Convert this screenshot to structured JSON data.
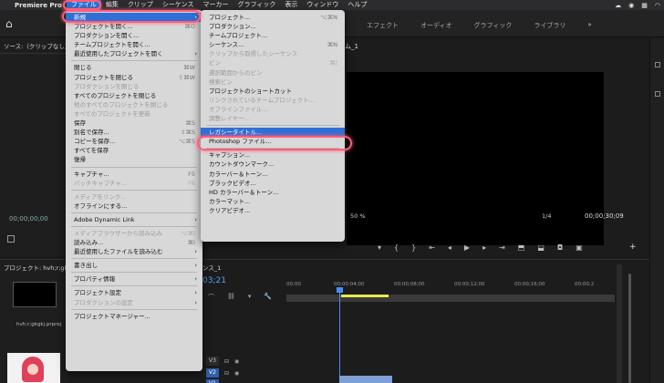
{
  "menubar": {
    "app_name": "Premiere Pro",
    "items": [
      "ファイル",
      "編集",
      "クリップ",
      "シーケンス",
      "マーカー",
      "グラフィック",
      "表示",
      "ウィンドウ",
      "ヘルプ"
    ]
  },
  "header": {
    "tabs": [
      "エフェクト",
      "オーディオ",
      "グラフィック",
      "ライブラリ"
    ],
    "more": "»"
  },
  "source_panel": {
    "title": "ソース:（クリップなし）",
    "timecode": "00;00;00;00"
  },
  "program_monitor": {
    "title": "ム_1",
    "zoom": "50 %",
    "fraction": "1/4",
    "end_timecode": "00;00;30;09"
  },
  "project_panel": {
    "title": "プロジェクト: hvh;r;gkgkj",
    "file_name": "hvh;r;gkgkj.prproj"
  },
  "timeline": {
    "title": "ンス_1",
    "timecode": "03;21",
    "ruler": [
      "00;00",
      "00;00;04;00",
      "00;00;08;00",
      "00;00;12;00",
      "00;00;16;00",
      "00;00;2"
    ],
    "tracks": [
      {
        "label": "V3",
        "active": false
      },
      {
        "label": "V2",
        "active": true
      },
      {
        "label": "V1",
        "active": true
      }
    ]
  },
  "file_menu": [
    {
      "label": "新規",
      "shortcut": "",
      "arrow": true,
      "highlight": true
    },
    {
      "label": "プロジェクトを開く...",
      "shortcut": "⌘O"
    },
    {
      "label": "プロダクションを開く...",
      "shortcut": ""
    },
    {
      "label": "チームプロジェクトを開く...",
      "shortcut": ""
    },
    {
      "label": "最近使用したプロジェクトを開く",
      "shortcut": "",
      "arrow": true
    },
    {
      "sep": true
    },
    {
      "label": "閉じる",
      "shortcut": "⌘W"
    },
    {
      "label": "プロジェクトを閉じる",
      "shortcut": "⇧⌘W"
    },
    {
      "label": "プロダクションを閉じる",
      "disabled": true
    },
    {
      "label": "すべてのプロジェクトを閉じる"
    },
    {
      "label": "他のすべてのプロジェクトを閉じる",
      "disabled": true
    },
    {
      "label": "すべてのプロジェクトを更新",
      "disabled": true
    },
    {
      "label": "保存",
      "shortcut": "⌘S"
    },
    {
      "label": "別名で保存...",
      "shortcut": "⇧⌘S"
    },
    {
      "label": "コピーを保存...",
      "shortcut": "⌥⌘S"
    },
    {
      "label": "すべてを保存"
    },
    {
      "label": "復帰"
    },
    {
      "sep": true
    },
    {
      "label": "キャプチャ...",
      "shortcut": "F5"
    },
    {
      "label": "バッチキャプチャ...",
      "shortcut": "F6",
      "disabled": true
    },
    {
      "sep": true
    },
    {
      "label": "メディアをリンク...",
      "disabled": true
    },
    {
      "label": "オフラインにする...",
      "shortcut": ""
    },
    {
      "sep": true
    },
    {
      "label": "Adobe Dynamic Link",
      "arrow": true
    },
    {
      "sep": true
    },
    {
      "label": "メディアブラウザーから読み込み",
      "shortcut": "⌥⌘I",
      "disabled": true
    },
    {
      "label": "読み込み...",
      "shortcut": "⌘I"
    },
    {
      "label": "最近使用したファイルを読み込む",
      "arrow": true
    },
    {
      "sep": true
    },
    {
      "label": "書き出し",
      "arrow": true
    },
    {
      "sep": true
    },
    {
      "label": "プロパティ情報",
      "arrow": true
    },
    {
      "sep": true
    },
    {
      "label": "プロジェクト設定",
      "arrow": true
    },
    {
      "label": "プロダクションの設定",
      "arrow": true,
      "disabled": true
    },
    {
      "sep": true
    },
    {
      "label": "プロジェクトマネージャー..."
    }
  ],
  "new_submenu": [
    {
      "label": "プロジェクト...",
      "shortcut": "⌥⌘N"
    },
    {
      "label": "プロダクション..."
    },
    {
      "label": "チームプロジェクト..."
    },
    {
      "label": "シーケンス...",
      "shortcut": "⌘N"
    },
    {
      "label": "クリップから取得したシーケンス",
      "disabled": true
    },
    {
      "label": "ビン",
      "shortcut": "⌘/",
      "disabled": true
    },
    {
      "label": "選択範囲からのビン",
      "disabled": true
    },
    {
      "label": "検索ビン",
      "disabled": true
    },
    {
      "label": "プロジェクトのショートカット"
    },
    {
      "label": "リンクされているチームプロジェクト...",
      "disabled": true
    },
    {
      "label": "オフラインファイル...",
      "disabled": true
    },
    {
      "label": "調整レイヤー...",
      "disabled": true
    },
    {
      "sep": true
    },
    {
      "label": "レガシータイトル...",
      "highlight": true
    },
    {
      "label": "Photoshop ファイル..."
    },
    {
      "sep": true
    },
    {
      "label": "キャプション..."
    },
    {
      "label": "カウントダウンマーク..."
    },
    {
      "label": "カラーバー＆トーン..."
    },
    {
      "label": "ブラックビデオ..."
    },
    {
      "label": "HD カラーバー＆トーン..."
    },
    {
      "label": "カラーマット..."
    },
    {
      "label": "クリアビデオ..."
    }
  ]
}
